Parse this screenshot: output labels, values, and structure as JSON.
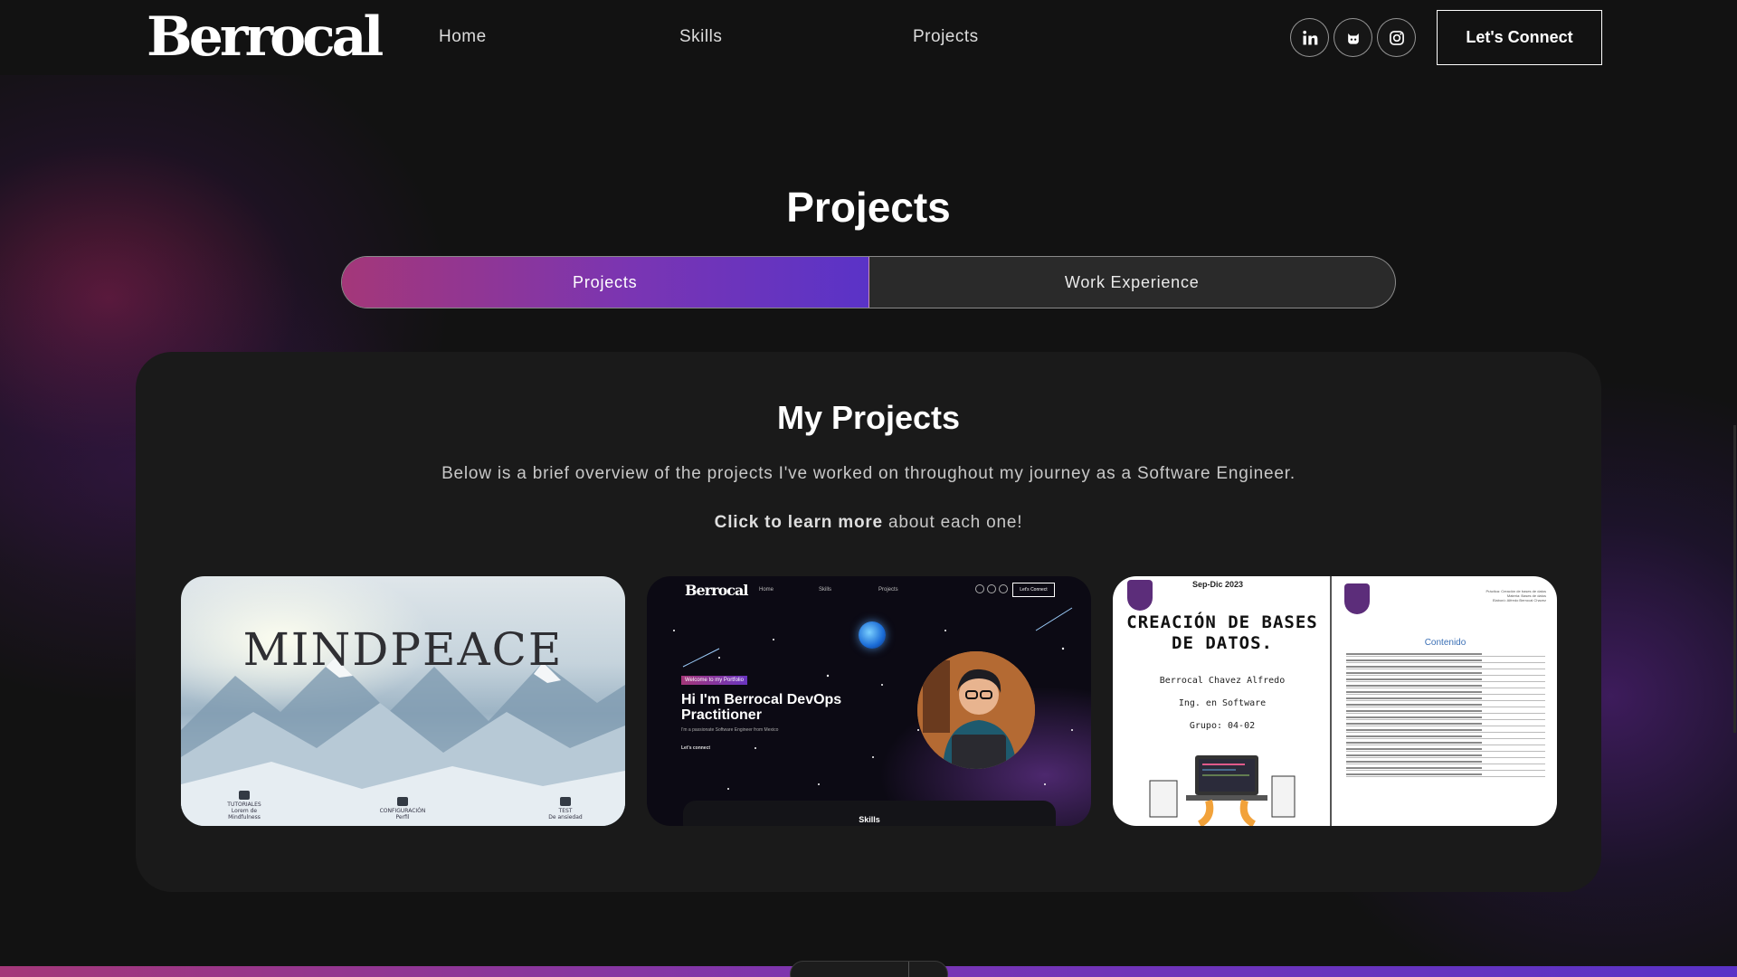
{
  "nav": {
    "logo": "Berrocal",
    "links": [
      {
        "label": "Home"
      },
      {
        "label": "Skills"
      },
      {
        "label": "Projects"
      }
    ],
    "social_icons": [
      "linkedin-icon",
      "github-icon",
      "instagram-icon"
    ],
    "cta_label": "Let's Connect"
  },
  "section": {
    "title": "Projects",
    "tabs": [
      {
        "label": "Projects",
        "active": true
      },
      {
        "label": "Work Experience",
        "active": false
      }
    ]
  },
  "projects_card": {
    "title": "My Projects",
    "description": "Below is a brief overview of the projects I've worked on throughout my journey as a Software Engineer.",
    "cta_bold": "Click to learn more",
    "cta_rest": " about each one!"
  },
  "thumbnails": {
    "mindpeace": {
      "title": "MINDPEACE",
      "menu": [
        {
          "label": "TUTORIALES",
          "sub": "Lorem de Mindfulness"
        },
        {
          "label": "CONFIGURACIÓN",
          "sub": "Perfil"
        },
        {
          "label": "TEST",
          "sub": "De ansiedad"
        }
      ]
    },
    "portfolio": {
      "logo": "Berrocal",
      "nav": [
        "Home",
        "Skills",
        "Projects"
      ],
      "cta": "Let's Connect",
      "badge": "Welcome to my Portfolio",
      "headline": "Hi I'm Berrocal DevOps Practitioner",
      "sub": "I'm a passionate Software Engineer from Mexico",
      "link": "Let's connect",
      "skills": "Skills"
    },
    "database": {
      "date": "Sep-Dic 2023",
      "title": "CREACIÓN DE BASES DE DATOS.",
      "author": "Berrocal Chavez Alfredo",
      "career": "Ing. en Software",
      "group": "Grupo: 04-02",
      "meta": [
        "Práctica: Creación de bases de datos",
        "Materia: Bases de datos",
        "Elaboró: Alfredo Berrocal Chavez"
      ],
      "contents_title": "Contenido"
    }
  },
  "colors": {
    "accent_start": "#a43779",
    "accent_end": "#5a33c7",
    "background": "#121212",
    "card": "#1a1a1a"
  }
}
